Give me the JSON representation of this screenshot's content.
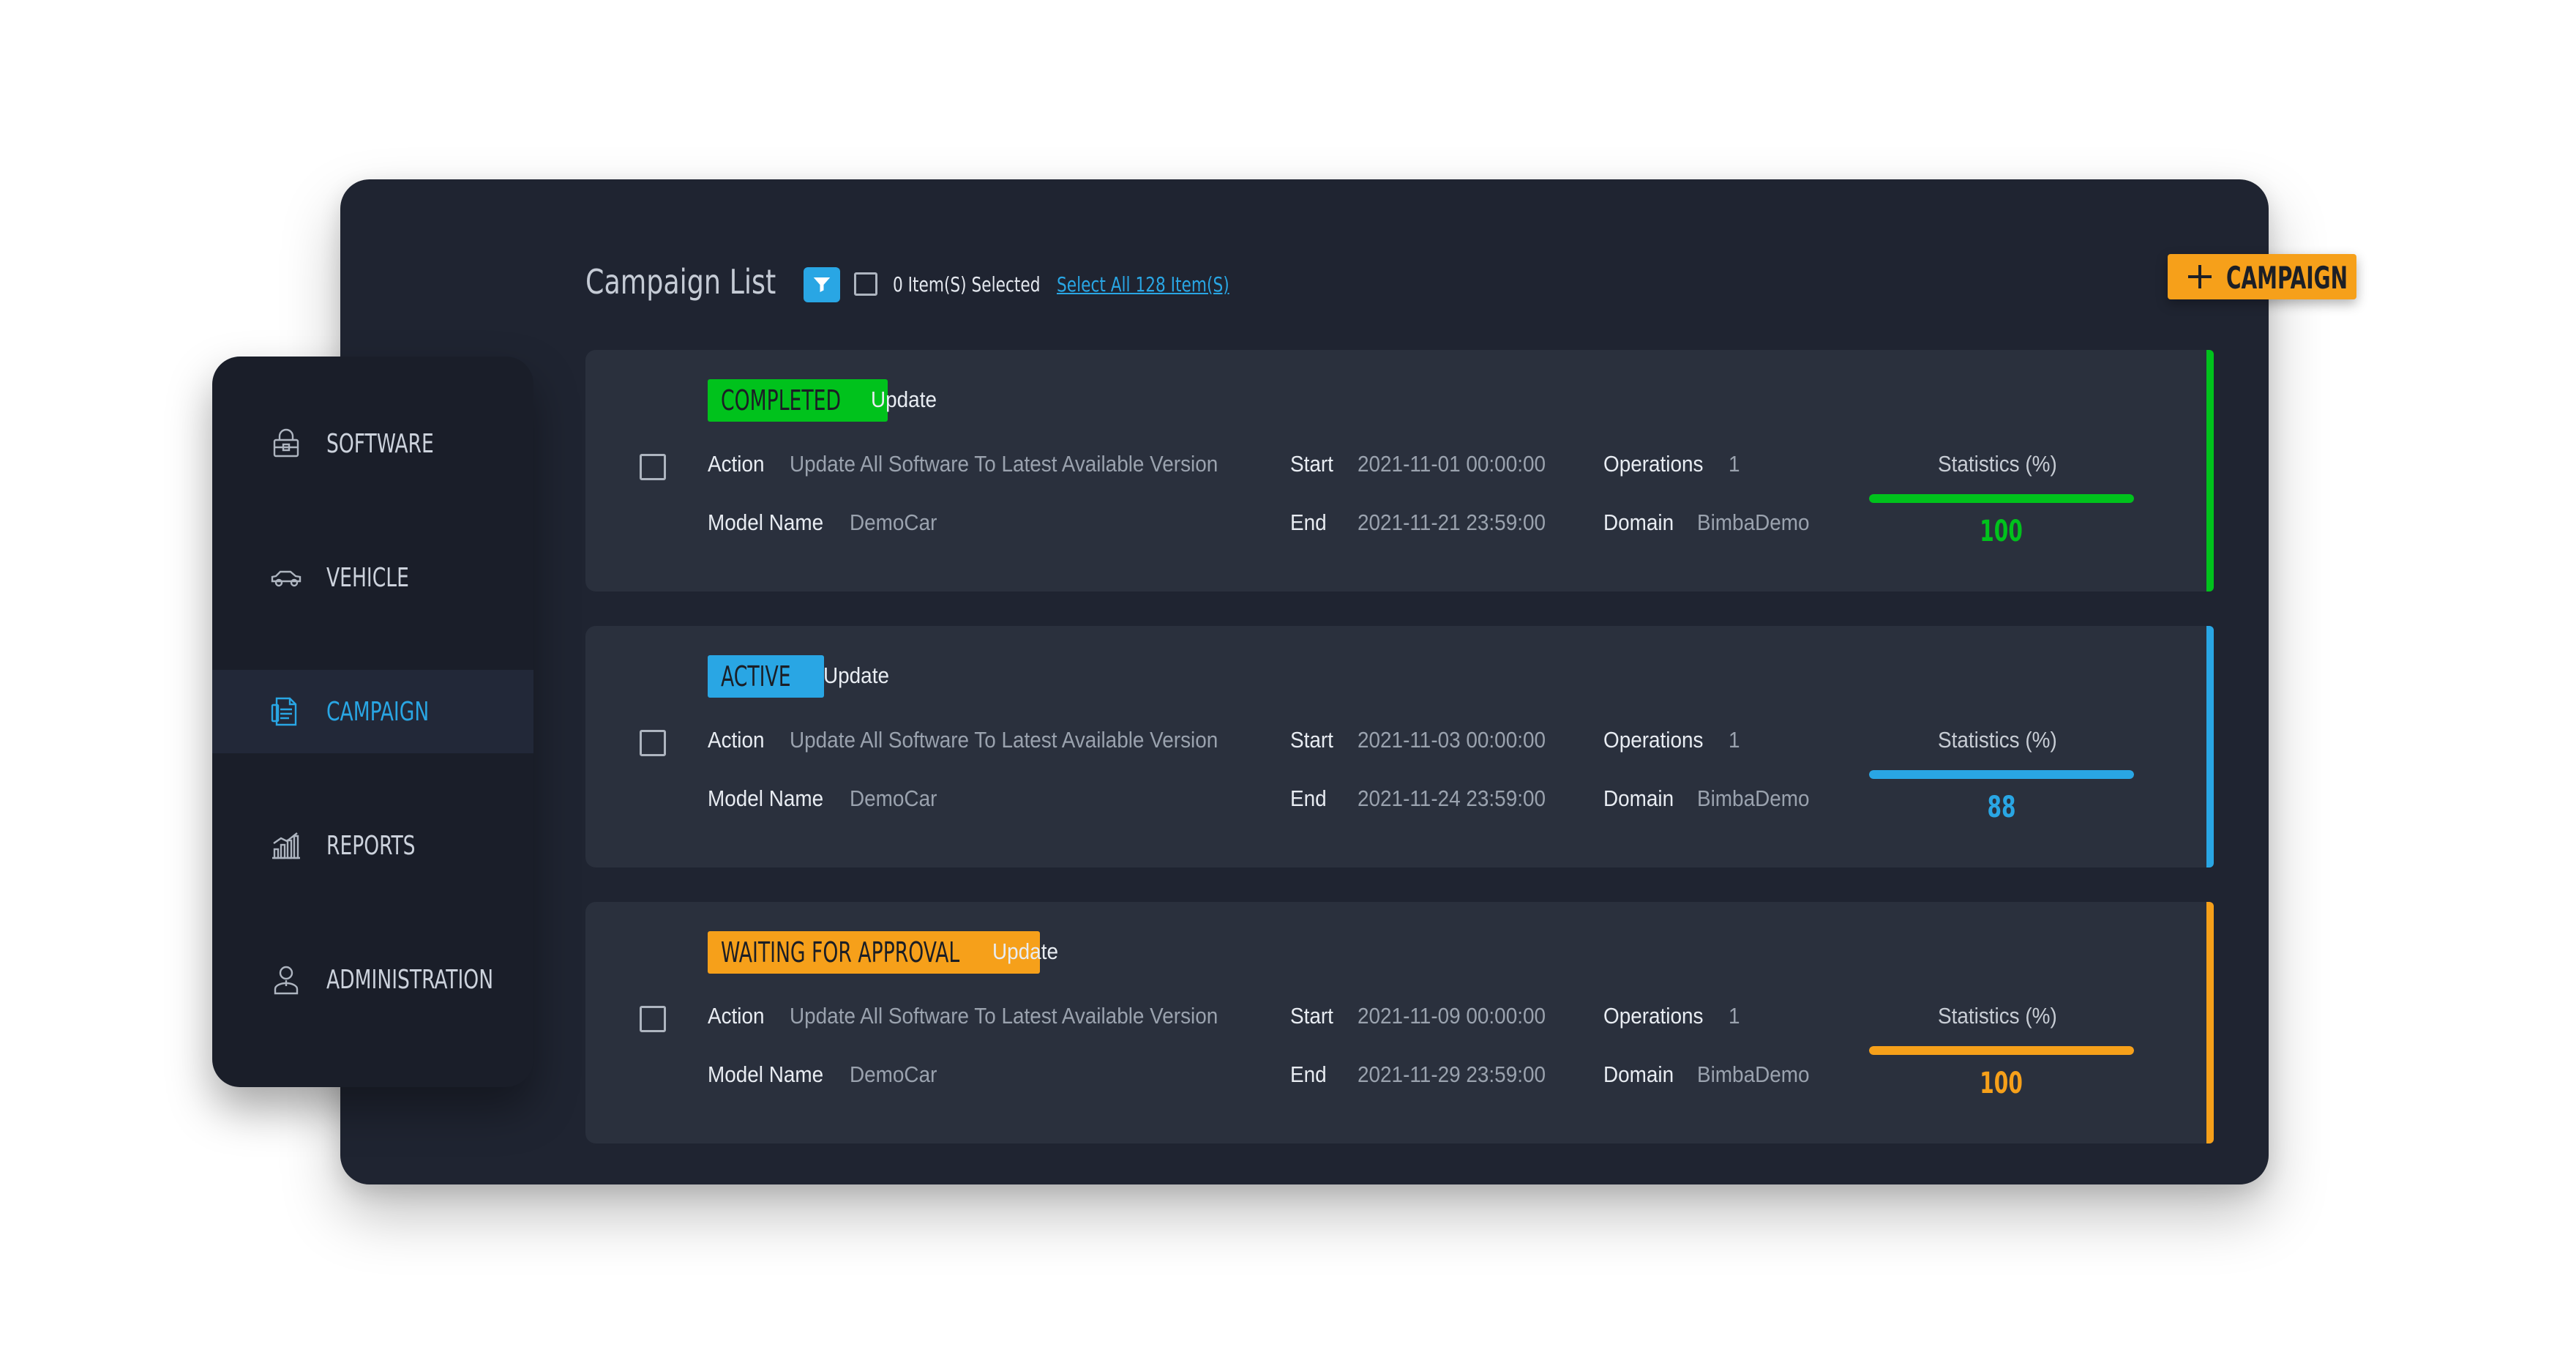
{
  "header": {
    "title": "Campaign List",
    "selected_text": "0 Item(S) Selected",
    "select_all_link": "Select All 128 Item(S)",
    "add_button_label": "CAMPAIGN"
  },
  "sidebar": {
    "items": [
      {
        "label": "SOFTWARE",
        "icon": "lock-package-icon",
        "active": false
      },
      {
        "label": "VEHICLE",
        "icon": "car-icon",
        "active": false
      },
      {
        "label": "CAMPAIGN",
        "icon": "document-icon",
        "active": true
      },
      {
        "label": "REPORTS",
        "icon": "bar-chart-icon",
        "active": false
      },
      {
        "label": "ADMINISTRATION",
        "icon": "user-icon",
        "active": false
      }
    ]
  },
  "colors": {
    "completed": "#00c21c",
    "active": "#29a6e4",
    "waiting": "#f6a01a"
  },
  "campaigns": [
    {
      "status": "COMPLETED",
      "type": "Update",
      "action_label": "Action",
      "action_value": "Update All Software To Latest Available Version",
      "model_label": "Model Name",
      "model_value": "DemoCar",
      "start_label": "Start",
      "start_value": "2021-11-01 00:00:00",
      "end_label": "End",
      "end_value": "2021-11-21 23:59:00",
      "operations_label": "Operations",
      "operations_value": "1",
      "domain_label": "Domain",
      "domain_value": "BimbaDemo",
      "stats_label": "Statistics (%)",
      "stats_value": "100",
      "stats_percent": 100
    },
    {
      "status": "ACTIVE",
      "type": "Update",
      "action_label": "Action",
      "action_value": "Update All Software To Latest Available Version",
      "model_label": "Model Name",
      "model_value": "DemoCar",
      "start_label": "Start",
      "start_value": "2021-11-03 00:00:00",
      "end_label": "End",
      "end_value": "2021-11-24 23:59:00",
      "operations_label": "Operations",
      "operations_value": "1",
      "domain_label": "Domain",
      "domain_value": "BimbaDemo",
      "stats_label": "Statistics (%)",
      "stats_value": "88",
      "stats_percent": 100
    },
    {
      "status": "WAITING FOR APPROVAL",
      "type": "Update",
      "action_label": "Action",
      "action_value": "Update All Software To Latest Available Version",
      "model_label": "Model Name",
      "model_value": "DemoCar",
      "start_label": "Start",
      "start_value": "2021-11-09 00:00:00",
      "end_label": "End",
      "end_value": "2021-11-29 23:59:00",
      "operations_label": "Operations",
      "operations_value": "1",
      "domain_label": "Domain",
      "domain_value": "BimbaDemo",
      "stats_label": "Statistics (%)",
      "stats_value": "100",
      "stats_percent": 100
    }
  ]
}
